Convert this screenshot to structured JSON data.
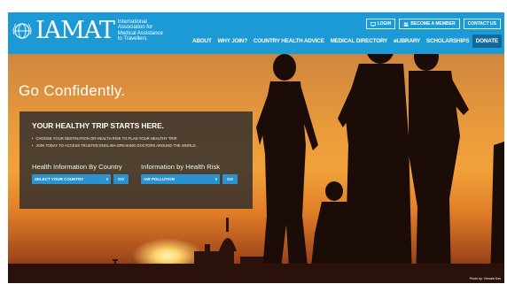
{
  "brand": {
    "name": "IAMAT",
    "description_lines": [
      "International",
      "Association for",
      "Medical Assistance",
      "to Travellers"
    ]
  },
  "top_buttons": [
    {
      "label": "LOGIN",
      "icon": "monitor-icon"
    },
    {
      "label": "BECOME A MEMBER",
      "icon": "members-icon"
    },
    {
      "label": "CONTACT US",
      "icon": ""
    }
  ],
  "nav": [
    {
      "label": "ABOUT"
    },
    {
      "label": "WHY JOIN?"
    },
    {
      "label": "COUNTRY HEALTH ADVICE"
    },
    {
      "label": "MEDICAL DIRECTORY"
    },
    {
      "label": "eLIBRARY"
    },
    {
      "label": "SCHOLARSHIPS"
    },
    {
      "label": "DONATE"
    }
  ],
  "hero": {
    "tagline": "Go Confidently.",
    "photo_credit": "Photo by: Vlenala Kes"
  },
  "panel": {
    "title": "YOUR HEALTHY TRIP STARTS HERE.",
    "bullets": [
      "CHOOSE YOUR DESTINATION OR HEALTH RISK TO PLAN YOUR HEALTHY TRIP.",
      "JOIN TODAY TO ACCESS TRUSTED ENGLISH-SPEAKING DOCTORS AROUND THE WORLD."
    ],
    "country": {
      "label": "Health Information By Country",
      "selected": "SELECT YOUR COUNTRY",
      "go": "GO"
    },
    "risk": {
      "label": "Information by Health Risk",
      "selected": "AIR POLLUTION",
      "go": "GO"
    }
  },
  "colors": {
    "header_blue": "#1c9ad6",
    "donate_blue": "#13689a",
    "control_blue": "#2a92cf",
    "panel_bg": "#28282c"
  }
}
